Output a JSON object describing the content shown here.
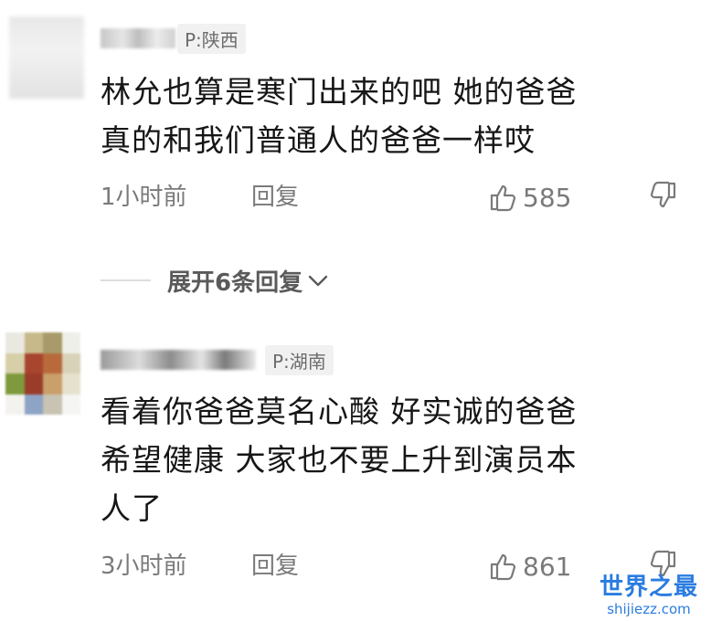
{
  "comments": [
    {
      "ip": "P:陕西",
      "text_line1": "林允也算是寒门出来的吧 她的爸爸",
      "text_line2": "真的和我们普通人的爸爸一样哎",
      "time": "1小时前",
      "reply": "回复",
      "likes": "585"
    },
    {
      "ip": "P:湖南",
      "text_line1": "看着你爸爸莫名心酸 好实诚的爸爸",
      "text_line2": "希望健康 大家也不要上升到演员本",
      "text_line3": "人了",
      "time": "3小时前",
      "reply": "回复",
      "likes": "861"
    }
  ],
  "expand_replies": "展开6条回复",
  "watermark": {
    "main": "世界之最",
    "sub": "shijiezz.com"
  },
  "colors": {
    "accent_watermark": "#2a7ce0",
    "meta_text": "#7a7a7a"
  }
}
